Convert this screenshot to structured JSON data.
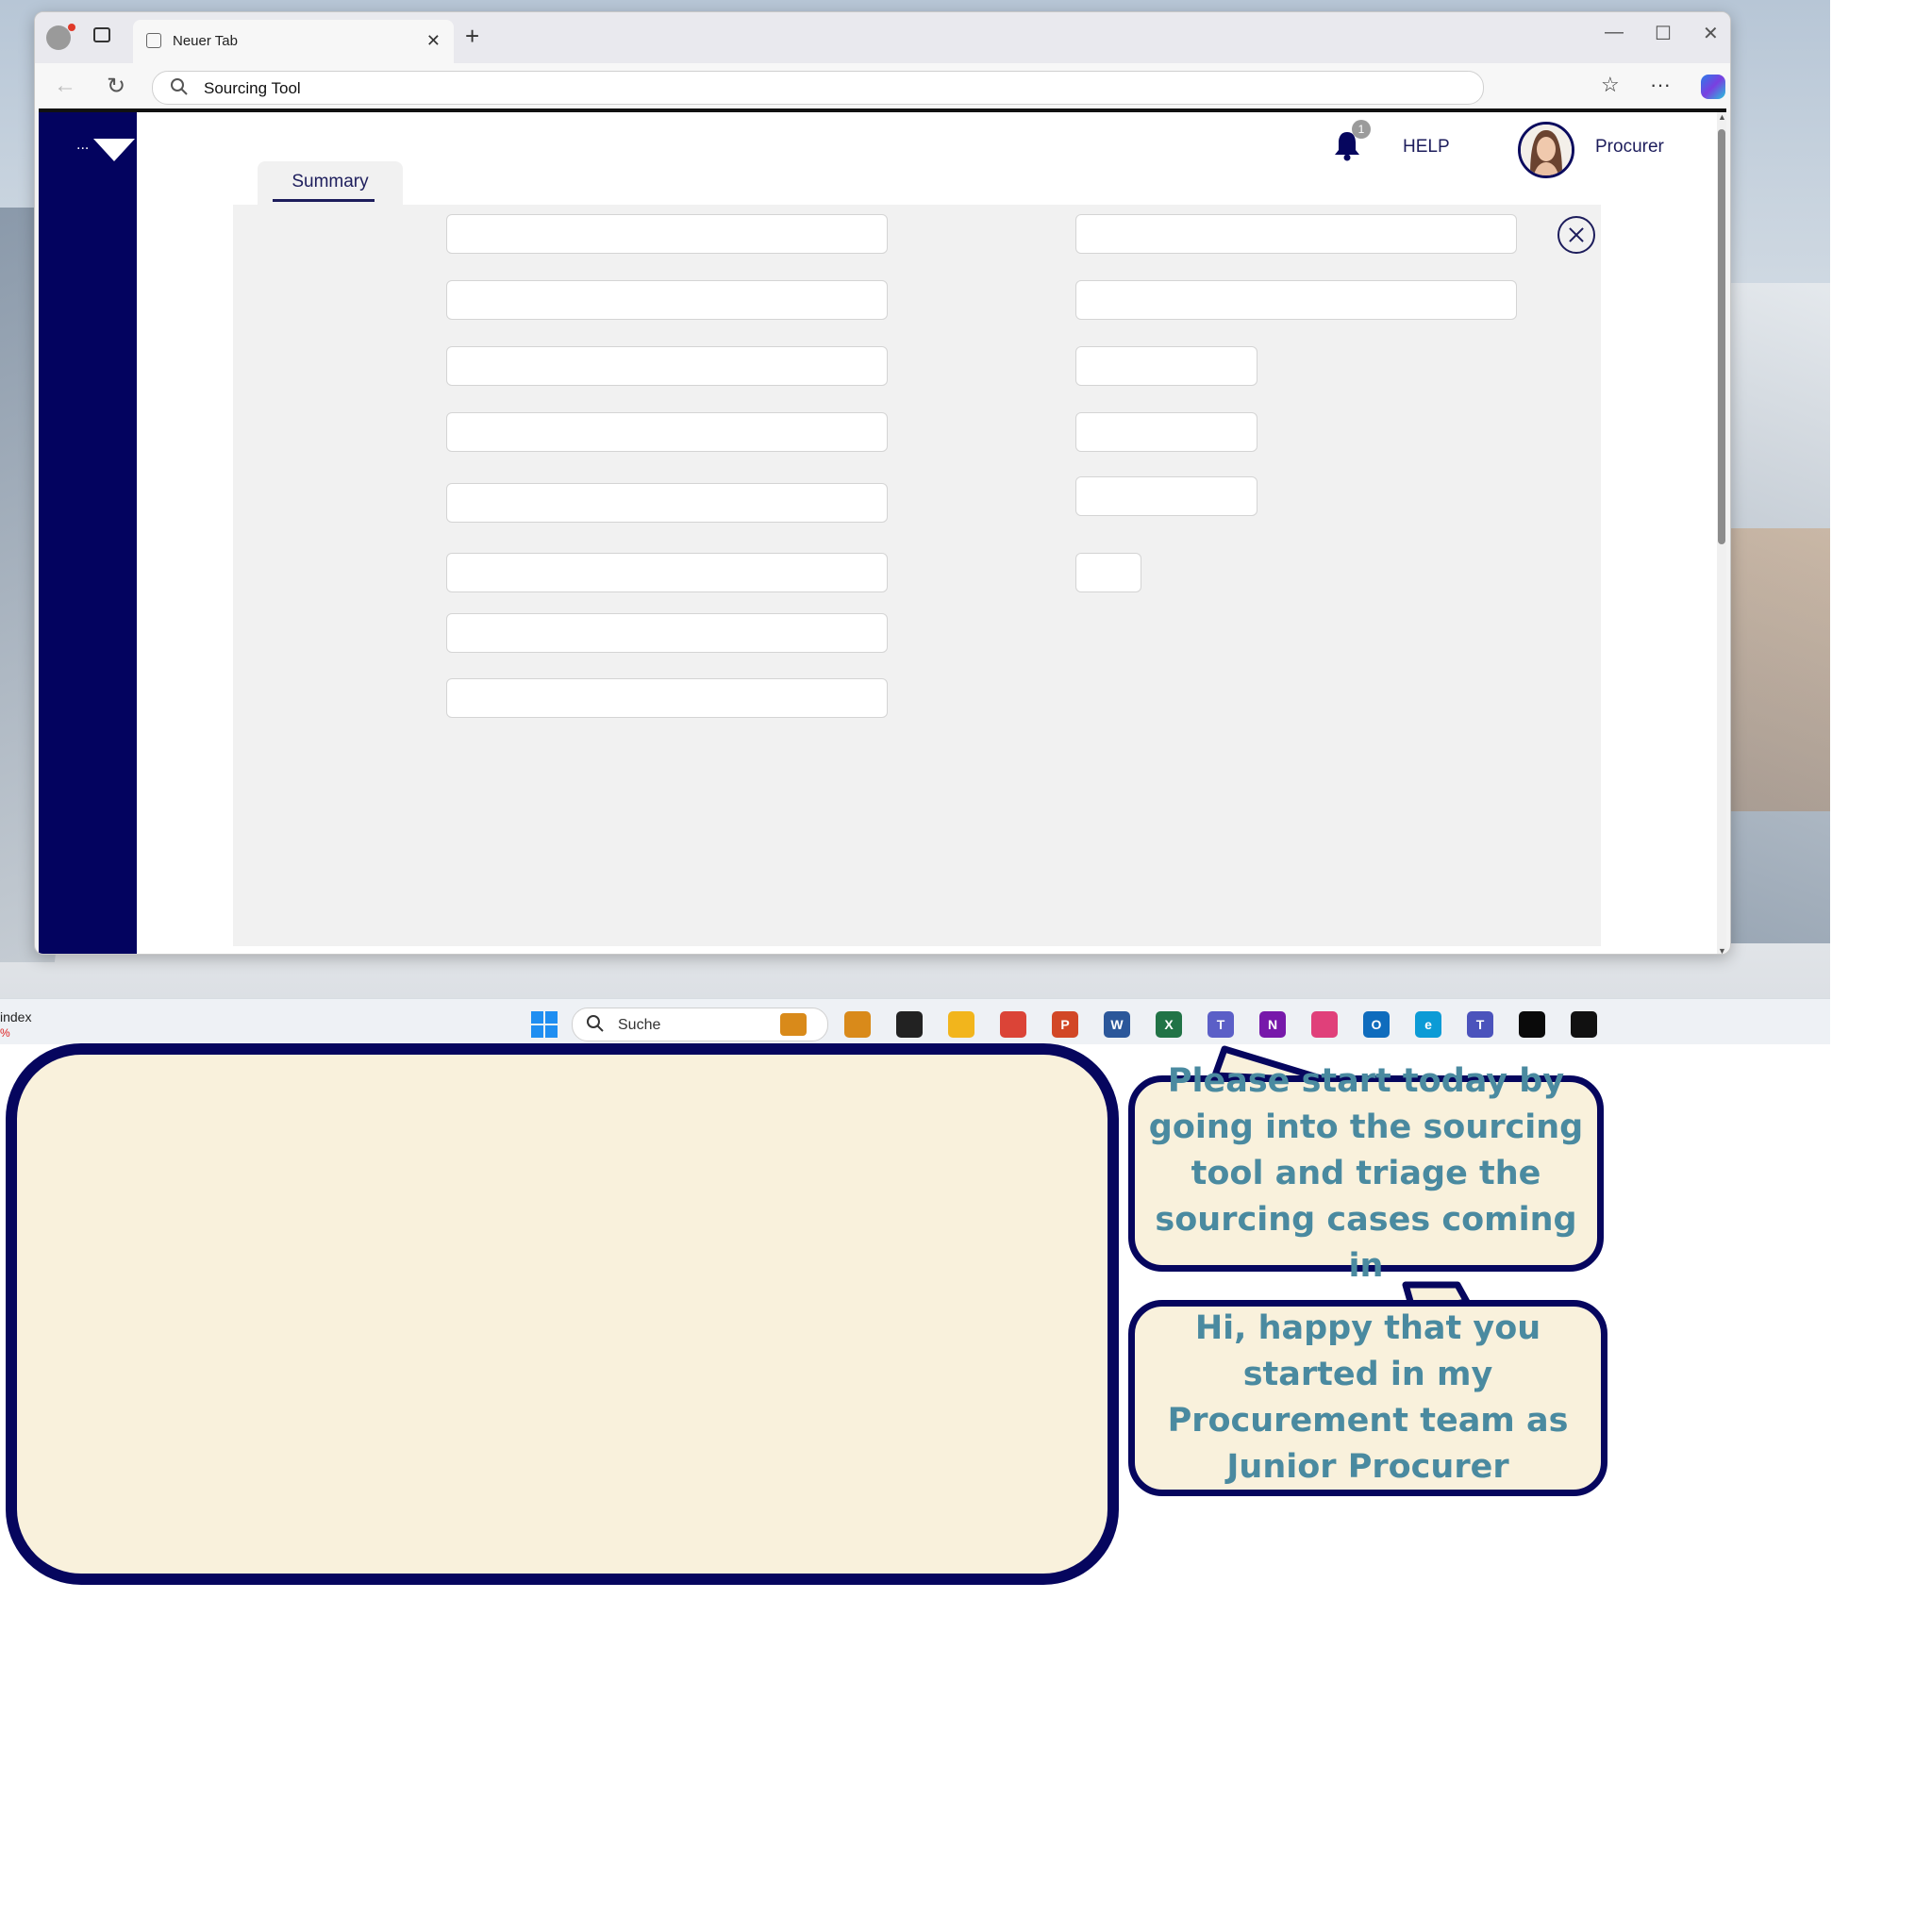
{
  "browser": {
    "tab_title": "Neuer Tab",
    "tab_close": "✕",
    "new_tab": "+",
    "minimize": "—",
    "maximize": "☐",
    "close": "✕",
    "back": "←",
    "reload": "↻",
    "address": "Sourcing Tool",
    "favorites": "☆",
    "more": "···"
  },
  "app": {
    "sidebar_menu": "...",
    "notification_count": "1",
    "help_label": "HELP",
    "user_role": "Procurer",
    "tabs": [
      {
        "label": "Summary",
        "active": true
      }
    ],
    "accent_color": "#03035f"
  },
  "taskbar": {
    "index_label": "index",
    "index_value": "%",
    "search_placeholder": "Suche",
    "apps": [
      {
        "name": "briefcase-icon",
        "color": "#d98a1a",
        "glyph": ""
      },
      {
        "name": "terminal-icon",
        "color": "#222222",
        "glyph": ""
      },
      {
        "name": "file-explorer-icon",
        "color": "#f2b51c",
        "glyph": ""
      },
      {
        "name": "chrome-icon",
        "color": "#db4437",
        "glyph": ""
      },
      {
        "name": "powerpoint-icon",
        "color": "#d24726",
        "glyph": "P"
      },
      {
        "name": "word-icon",
        "color": "#2b579a",
        "glyph": "W"
      },
      {
        "name": "excel-icon",
        "color": "#217346",
        "glyph": "X"
      },
      {
        "name": "teams-icon",
        "color": "#5b5fc7",
        "glyph": "T"
      },
      {
        "name": "onenote-icon",
        "color": "#7719aa",
        "glyph": "N"
      },
      {
        "name": "snipping-tool-icon",
        "color": "#e0407a",
        "glyph": ""
      },
      {
        "name": "outlook-icon",
        "color": "#0f6cbd",
        "glyph": "O"
      },
      {
        "name": "edge-icon",
        "color": "#0c9bd6",
        "glyph": "e"
      },
      {
        "name": "teams-new-icon",
        "color": "#4b53bc",
        "glyph": "T"
      },
      {
        "name": "webex-icon",
        "color": "#0a0a0a",
        "glyph": ""
      },
      {
        "name": "app-diamond-icon",
        "color": "#111111",
        "glyph": ""
      }
    ]
  },
  "dialog": {
    "message_1": "Please start today by going into the sourcing tool and triage the sourcing cases coming in",
    "message_2": "Hi, happy that you started in my Procurement team as Junior Procurer"
  }
}
